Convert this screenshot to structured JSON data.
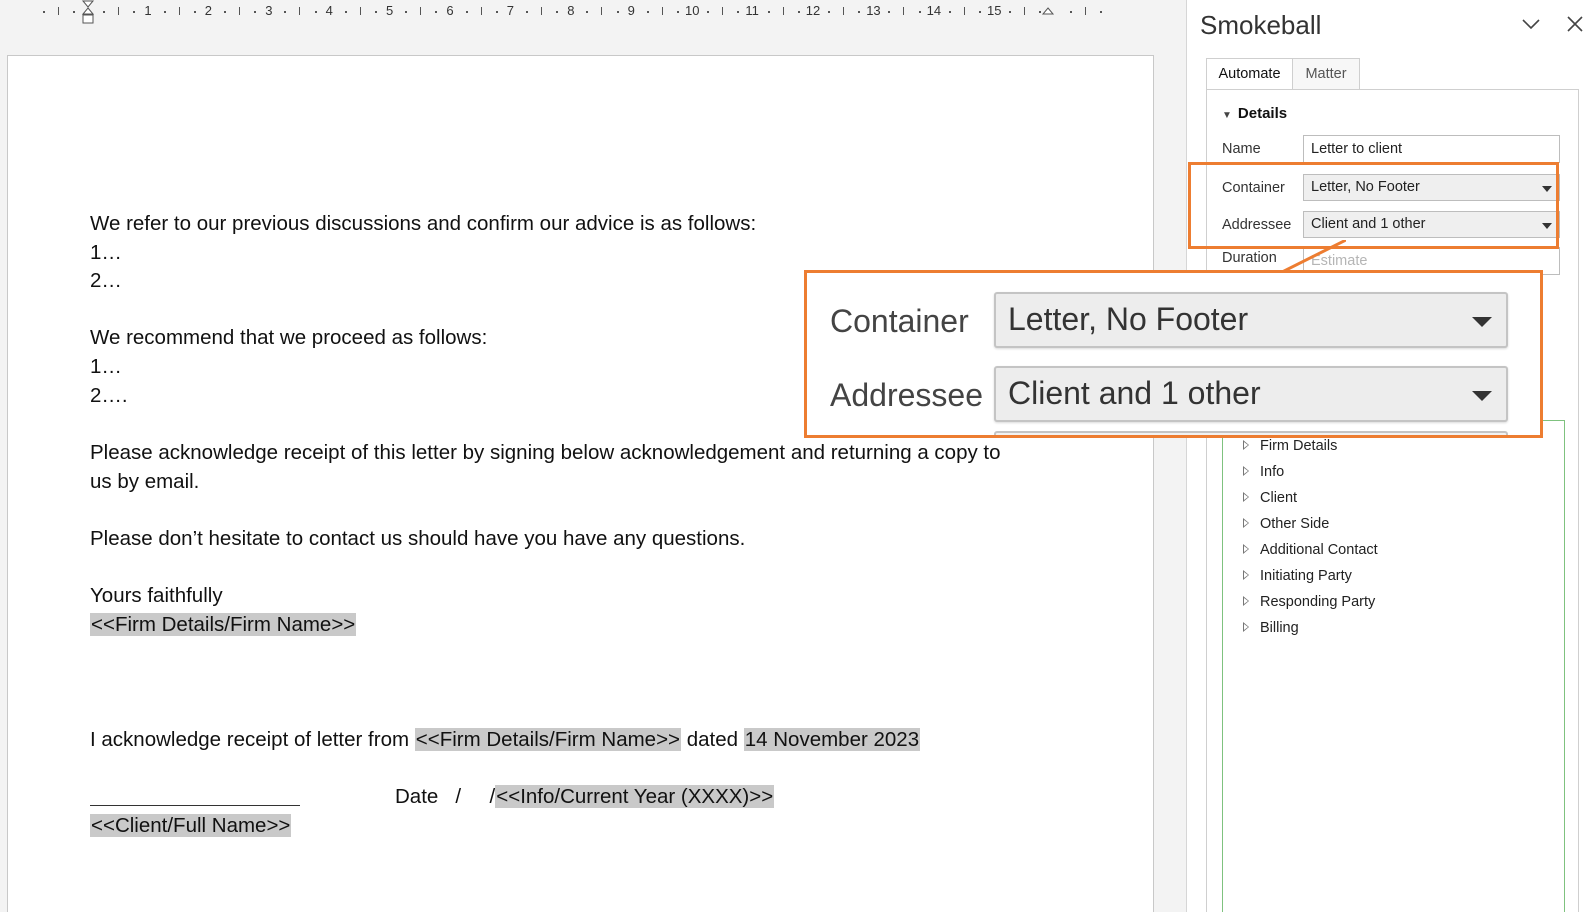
{
  "ruler": {
    "numbers": [
      "1",
      "2",
      "3",
      "4",
      "5",
      "6",
      "7",
      "8",
      "9",
      "10",
      "11",
      "12",
      "13",
      "14",
      "15"
    ]
  },
  "document": {
    "lines": [
      "We refer to our previous discussions and confirm our advice is as follows:",
      "1…",
      "2…",
      "We recommend that we proceed as follows:",
      "1…",
      "2….",
      "Please acknowledge receipt of this letter by signing below acknowledgement and returning a copy to",
      "us by email.",
      "Please don’t hesitate to contact us should have you have any questions.",
      "Yours faithfully"
    ],
    "firm_name_field": "<<Firm Details/Firm Name>>",
    "ack_prefix": "I acknowledge receipt of letter from ",
    "ack_field_firm": "<<Firm Details/Firm Name>>",
    "ack_dated": " dated ",
    "ack_field_date": "14 November 2023",
    "date_label": "Date   /     /",
    "year_field": "<<Info/Current Year (XXXX)>>",
    "client_field": "<<Client/Full Name>>"
  },
  "panel": {
    "title": "Smokeball",
    "tabs": [
      {
        "label": "Automate",
        "active": true
      },
      {
        "label": "Matter",
        "active": false
      }
    ],
    "details_heading": "Details",
    "fields": {
      "name": {
        "label": "Name",
        "value": "Letter to client"
      },
      "container": {
        "label": "Container",
        "value": "Letter, No Footer"
      },
      "addressee": {
        "label": "Addressee",
        "value": "Client and 1 other"
      },
      "duration": {
        "label": "Duration",
        "placeholder": "Estimate"
      }
    },
    "tree_items": [
      "Firm Details",
      "Info",
      "Client",
      "Other Side",
      "Additional Contact",
      "Initiating Party",
      "Responding Party",
      "Billing"
    ]
  },
  "callout": {
    "container_label": "Container",
    "container_value": "Letter, No Footer",
    "addressee_label": "Addressee",
    "addressee_value": "Client and 1 other"
  },
  "colors": {
    "highlight": "#ed7d31",
    "field_shading": "#c9c9c9",
    "tree_border": "#7fc27f"
  }
}
